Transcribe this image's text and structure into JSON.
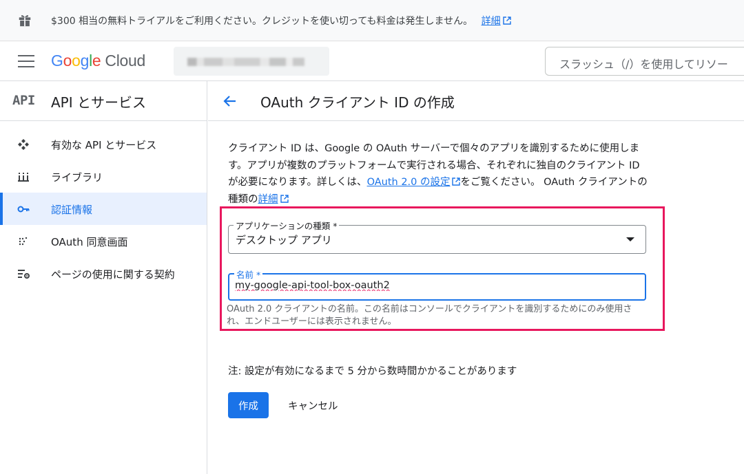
{
  "banner": {
    "icon": "gift-icon",
    "text": "$300 相当の無料トライアルをご利用ください。クレジットを使い切っても料金は発生しません。",
    "link": "詳細"
  },
  "topbar": {
    "menu_icon": "hamburger-menu-icon",
    "logo": {
      "g": "G",
      "o1": "o",
      "o2": "o",
      "g2": "g",
      "l": "l",
      "e": "e",
      "cloud": "Cloud"
    },
    "search_placeholder": "スラッシュ（/）を使用してリソー"
  },
  "sidebar": {
    "badge": "API",
    "title": "API とサービス",
    "items": [
      {
        "label": "有効な API とサービス",
        "icon": "enabled-apis-icon",
        "active": false
      },
      {
        "label": "ライブラリ",
        "icon": "library-icon",
        "active": false
      },
      {
        "label": "認証情報",
        "icon": "key-icon",
        "active": true
      },
      {
        "label": "OAuth 同意画面",
        "icon": "consent-screen-icon",
        "active": false
      },
      {
        "label": "ページの使用に関する契約",
        "icon": "page-usage-settings-icon",
        "active": false
      }
    ]
  },
  "main": {
    "title": "OAuth クライアント ID の作成",
    "description": {
      "part1": "クライアント ID は、Google の OAuth サーバーで個々のアプリを識別するために使用します。アプリが複数のプラットフォームで実行される場合、それぞれに独自のクライアント ID が必要になります。詳しくは、",
      "link1": "OAuth 2.0 の設定",
      "part2": "をご覧ください。 OAuth クライアントの種類の",
      "link2": "詳細"
    },
    "app_type": {
      "label": "アプリケーションの種類 *",
      "value": "デスクトップ アプリ"
    },
    "name": {
      "label": "名前 *",
      "value": "my-google-api-tool-box-oauth2",
      "hint": "OAuth 2.0 クライアントの名前。この名前はコンソールでクライアントを識別するためにのみ使用され、エンドユーザーには表示されません。"
    },
    "note": "注: 設定が有効になるまで 5 分から数時間かかることがあります",
    "create_label": "作成",
    "cancel_label": "キャンセル"
  },
  "colors": {
    "accent": "#1a73e8",
    "highlight": "#e8175d",
    "active_bg": "#e8f0fe"
  }
}
